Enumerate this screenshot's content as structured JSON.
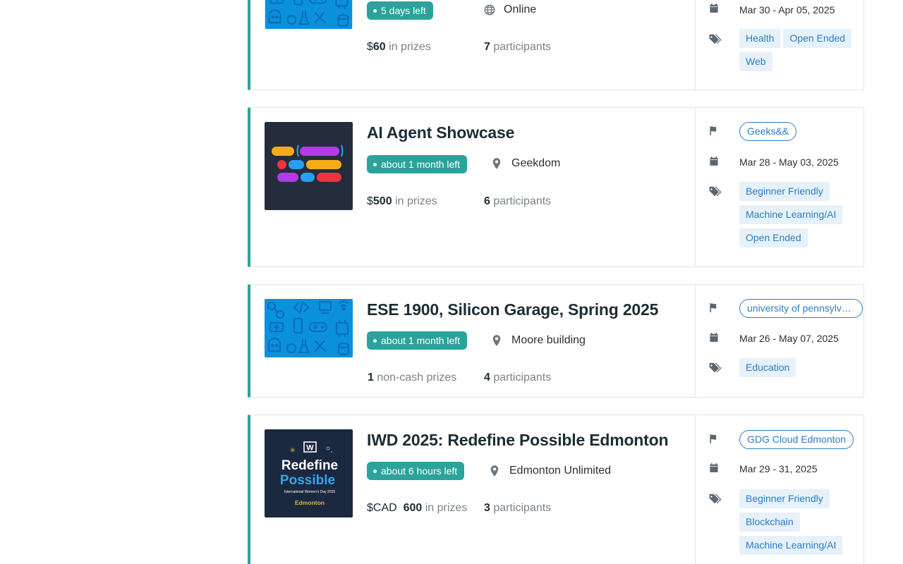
{
  "cards": [
    {
      "title": "",
      "time_left": "5 days left",
      "location": "Online",
      "location_icon": "globe-icon",
      "prize_currency": "$",
      "prize_amount": "60",
      "prize_suffix": "in prizes",
      "participants_count": "7",
      "participants_label": "participants",
      "host": "",
      "dates": "Mar 30 - Apr 05, 2025",
      "tags": [
        "Health",
        "Open Ended",
        "Web"
      ],
      "thumbnail": "devpost-default-pattern"
    },
    {
      "title": "AI Agent Showcase",
      "time_left": "about 1 month left",
      "location": "Geekdom",
      "location_icon": "map-pin-icon",
      "prize_currency": "$",
      "prize_amount": "500",
      "prize_suffix": "in prizes",
      "participants_count": "6",
      "participants_label": "participants",
      "host": "Geeks&&",
      "dates": "Mar 28 - May 03, 2025",
      "tags": [
        "Beginner Friendly",
        "Machine Learning/AI",
        "Open Ended"
      ],
      "thumbnail": "ai-agent-logo"
    },
    {
      "title": "ESE 1900, Silicon Garage, Spring 2025",
      "time_left": "about 1 month left",
      "location": "Moore building",
      "location_icon": "map-pin-icon",
      "prize_currency": "",
      "prize_amount": "1",
      "prize_suffix": "non-cash prizes",
      "participants_count": "4",
      "participants_label": "participants",
      "host": "university of pennsylva...",
      "dates": "Mar 26 - May 07, 2025",
      "tags": [
        "Education"
      ],
      "thumbnail": "devpost-default-pattern"
    },
    {
      "title": "IWD 2025: Redefine Possible Edmonton",
      "time_left": "about 6 hours left",
      "location": "Edmonton Unlimited",
      "location_icon": "map-pin-icon",
      "prize_currency": "$CAD",
      "prize_amount": "600",
      "prize_suffix": "in prizes",
      "participants_count": "3",
      "participants_label": "participants",
      "host": "GDG Cloud Edmonton",
      "dates": "Mar 29 - 31, 2025",
      "tags": [
        "Beginner Friendly",
        "Blockchain",
        "Machine Learning/AI"
      ],
      "thumbnail": "iwd-redefine-possible",
      "thumb_text": {
        "line1": "Redefine",
        "line2": "Possible",
        "small": "International Women's Day 2025",
        "city": "Edmonton"
      }
    }
  ],
  "colors": {
    "accent": "#2ca39a",
    "link": "#2e7cc4",
    "tag_bg": "#e6f1fa"
  }
}
